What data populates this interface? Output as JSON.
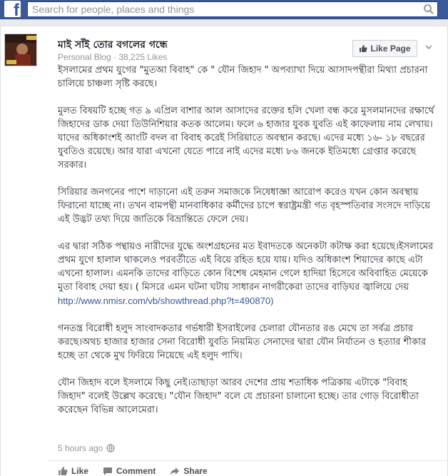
{
  "topbar": {
    "logo": "f",
    "search_placeholder": "Search for people, places and things",
    "search_icon": "search-icon"
  },
  "post": {
    "page_name": "মাই সাঁই তোর বগলের গন্ধে",
    "page_meta": "Personal Blog · 38,225 Likes",
    "like_page_label": "Like Page",
    "paragraphs": [
      "ইসলামের প্রথম যুগের \"মুতআ বিবাহ\" কে \" যৌন জিহাদ \" অপব্যাখা দিয়ে আসাদপন্থীরা মিথ্যা প্রচারনা চালিয়ে চাঞ্চল্য সৃষ্টি করছে।",
      "মুলত বিষয়টি হচ্ছে গত ৯ এপ্রিল বাশার আল আসাদের রক্তের হলি খেলা বন্ধ করে মুসলমানদের রক্ষার্থে জিহাদের ডাক দেয়া তিউনিশিয়ার কতক আলেম। ফলে ৬ হাজার যুবক যুবতি এই কাফেলায় নাম লেখায়।যাদের অধিকাংশই আংটি বদল বা বিবাহ করেই সিরিয়াতে অবস্থান করছে। এদের মধ্যে ১৬- ১৮ বছরের যুবতিও রয়েছে। আর যারা এখনো যেতে পারে নাই এদের মধ্যে ৮৬ জনকে ইতিমধ্যে গ্রেপ্তার করেছে সরকার।",
      "সিরিয়ার জনগনের পাশে দাড়ানো এই তরুন সমাজকে নিষেধাজ্ঞা আরোপ করেও যখন কোন অবস্থায় ফিরানো যাচ্ছে না। তখন বামপন্থী মানবাধিকার কর্মীদের চাপে স্বরাষ্ট্রমন্ত্রী গত বৃহস্পতিবার সংসদে দাড়িয়ে এই উদ্ভট তথ্য দিয়ে জাতিকে বিভ্রান্তিতে ফেলে দেয়।",
      "এর দ্বারা সঠিক পন্থায়ও নারীদের যুদ্ধে অংশগ্রহনের মত ইবাদতকে অনেকটা কটাক্ষ করা হয়েছে।ইসলামের প্রথম যুগে হালাল থাকলেও পরবর্তীতে এই বিয়ে রহিত হয়ে যায়। যদিও অধিকাংশ শিয়াদের কাছে এটা এখনো হালাল। এমনকি তাদের বাড়িতে কোন বিশেষ মেহমান গেলে হাদিয়া হিসেবে অবিবাহিত মেয়েকে মুতা বিবাহ দেয়া হয়। ( মিসরে এমন ঘটনা ঘটায় সাধারন নাগরীকেরা তাদের বাড়িঘর জ্বালিয়ে দেয়",
      "গনতন্ত্র বিরোধী হলুদ সাংবাদকতার গর্ভধারী ইসরাইলের চেলারা যৌনতার রঙ মেখে তা সর্বত্র প্রচার করছে।অথচ হাজার হাজার সেনা বিরোধী যুবতি নিয়মিত সেনাদের দ্বারা যৌন নির্যাতন ও হত্যার শীকার হচ্ছে তা থেকে মুখ ফিরিয়ে নিয়েছে এই হলুদ পাখি।",
      "যৌন জিহাদ বলে ইসলামে কিছু নেই।তাছাড়া আরব দেশের প্রায় শতাধিক পত্রিকায় এটাকে \"বিবাহ জিহাদ\" বলেই উল্লেখ করেছে। \"যৌন জিহাদ\" বলে যে প্রচারনা চালানো হচ্ছে। তার গোড় বিরোধীতা করেছেন বিভিন্ন আলেমেরা।"
    ],
    "link": "http://www.nmisr.com/vb/showthread.php?t=490870)",
    "timestamp": "5 hours ago",
    "audience_icon": "globe-icon",
    "actions": {
      "like": "Like",
      "comment": "Comment",
      "share": "Share"
    }
  }
}
